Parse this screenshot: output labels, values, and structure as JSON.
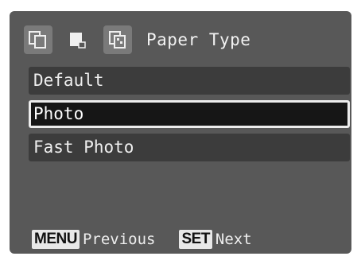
{
  "header": {
    "icons": [
      "page-layout-icon",
      "paper-page-icon",
      "print-effect-icon"
    ],
    "title": "Paper Type"
  },
  "menu": {
    "items": [
      "Default",
      "Photo",
      "Fast Photo"
    ],
    "selected_index": 1
  },
  "footer": {
    "menu_key": "MENU",
    "menu_label": "Previous",
    "set_key": "SET",
    "set_label": "Next"
  },
  "colors": {
    "screen_background": "#585858",
    "item_background": "#3c3c3c",
    "selected_background": "#161616",
    "text": "#eeeeee"
  }
}
